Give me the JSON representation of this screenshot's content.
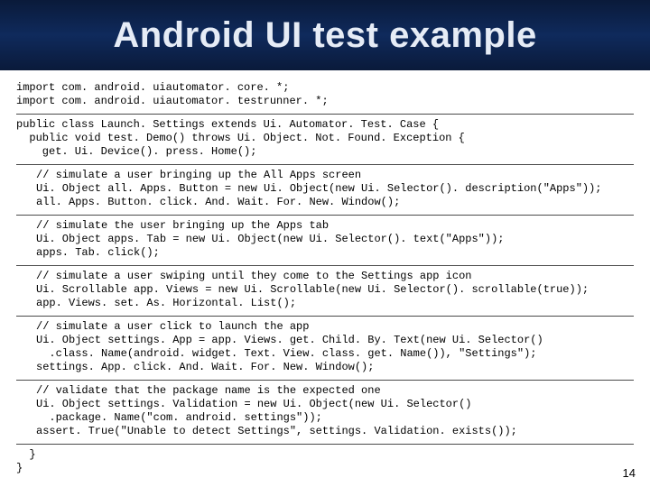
{
  "title": "Android UI test example",
  "code": {
    "imports": "import com. android. uiautomator. core. *;\nimport com. android. uiautomator. testrunner. *;",
    "class_decl": "public class Launch. Settings extends Ui. Automator. Test. Case {\n  public void test. Demo() throws Ui. Object. Not. Found. Exception {\n    get. Ui. Device(). press. Home();",
    "block1": "// simulate a user bringing up the All Apps screen\nUi. Object all. Apps. Button = new Ui. Object(new Ui. Selector(). description(\"Apps\"));\nall. Apps. Button. click. And. Wait. For. New. Window();",
    "block2": "// simulate the user bringing up the Apps tab\nUi. Object apps. Tab = new Ui. Object(new Ui. Selector(). text(\"Apps\"));\napps. Tab. click();",
    "block3": "// simulate a user swiping until they come to the Settings app icon\nUi. Scrollable app. Views = new Ui. Scrollable(new Ui. Selector(). scrollable(true));\napp. Views. set. As. Horizontal. List();",
    "block4": "// simulate a user click to launch the app\nUi. Object settings. App = app. Views. get. Child. By. Text(new Ui. Selector()\n  .class. Name(android. widget. Text. View. class. get. Name()), \"Settings\");\nsettings. App. click. And. Wait. For. New. Window();",
    "block5": "// validate that the package name is the expected one\nUi. Object settings. Validation = new Ui. Object(new Ui. Selector()\n  .package. Name(\"com. android. settings\"));\nassert. True(\"Unable to detect Settings\", settings. Validation. exists());",
    "close": "  }\n}"
  },
  "page_number": "14"
}
